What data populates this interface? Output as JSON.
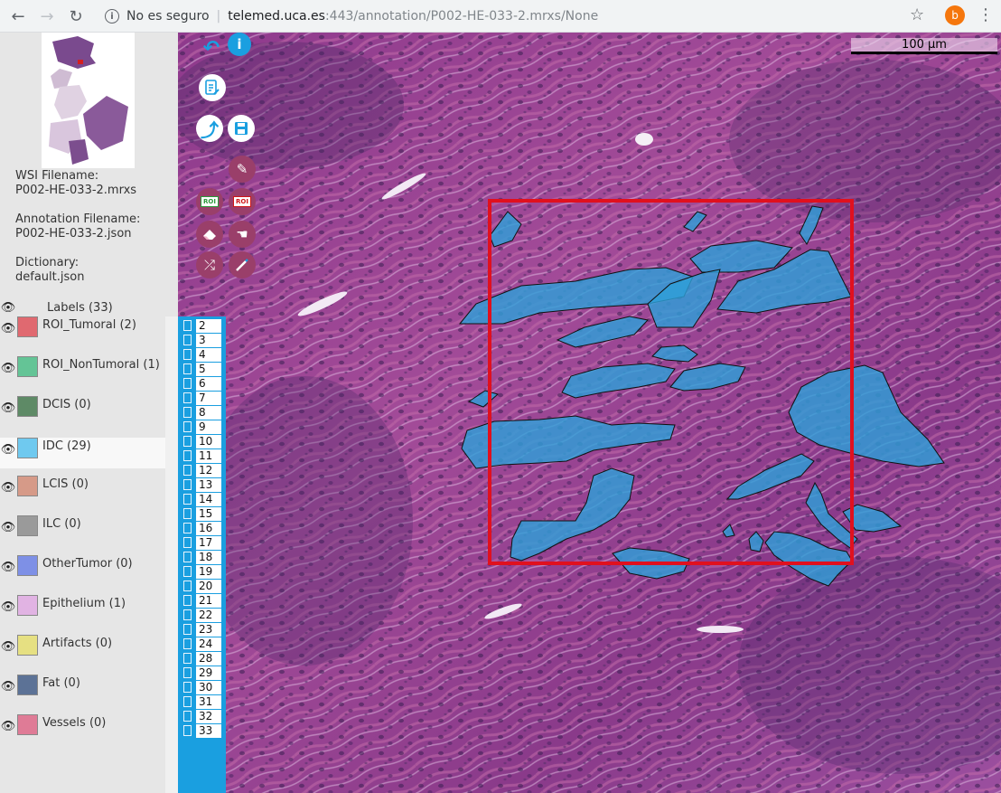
{
  "browser": {
    "security": "No es seguro",
    "host": "telemed.uca.es",
    "path": ":443/annotation/P002-HE-033-2.mrxs/None",
    "avatar_letter": "b"
  },
  "sidebar": {
    "wsi_label": "WSI Filename:",
    "wsi_value": "P002-HE-033-2.mrxs",
    "annotation_label": "Annotation Filename:",
    "annotation_value": "P002-HE-033-2.json",
    "dictionary_label": "Dictionary:",
    "dictionary_value": "default.json",
    "labels_title": "Labels (33)",
    "labels": [
      {
        "name": "ROI_Tumoral (2)",
        "color": "#e06970"
      },
      {
        "name": "ROI_NonTumoral (1)",
        "color": "#64c496"
      },
      {
        "name": "DCIS (0)",
        "color": "#5e8a66"
      },
      {
        "name": "IDC (29)",
        "color": "#6fc9ef"
      },
      {
        "name": "LCIS (0)",
        "color": "#d69a88"
      },
      {
        "name": "ILC (0)",
        "color": "#9a9a9a"
      },
      {
        "name": "OtherTumor (0)",
        "color": "#7e90e6"
      },
      {
        "name": "Epithelium (1)",
        "color": "#e1b3e3"
      },
      {
        "name": "Artifacts (0)",
        "color": "#e6e082"
      },
      {
        "name": "Fat (0)",
        "color": "#5c7296"
      },
      {
        "name": "Vessels (0)",
        "color": "#df7b96"
      }
    ],
    "selected_label": "IDC (29)"
  },
  "regions": [
    "2",
    "3",
    "4",
    "5",
    "6",
    "7",
    "8",
    "9",
    "10",
    "11",
    "12",
    "13",
    "14",
    "15",
    "16",
    "17",
    "18",
    "19",
    "20",
    "21",
    "22",
    "23",
    "24",
    "28",
    "29",
    "30",
    "31",
    "32",
    "33"
  ],
  "viewer": {
    "scale_bar": "100 µm",
    "tools": [
      "undo-icon",
      "info-icon",
      "edit-document-icon",
      "upload-icon",
      "save-icon",
      "pencil-icon",
      "roi-tumoral-icon",
      "roi-nontumoral-icon",
      "eraser-icon",
      "hand-icon",
      "shuffle-icon",
      "magic-wand-icon"
    ],
    "roi_tool_text": "ROI",
    "info_glyph": "i",
    "colors": {
      "roi_outline": "#e0101e",
      "annotation_fill": "#2e9fd8",
      "tissue_base": "#9a3a8e"
    }
  }
}
